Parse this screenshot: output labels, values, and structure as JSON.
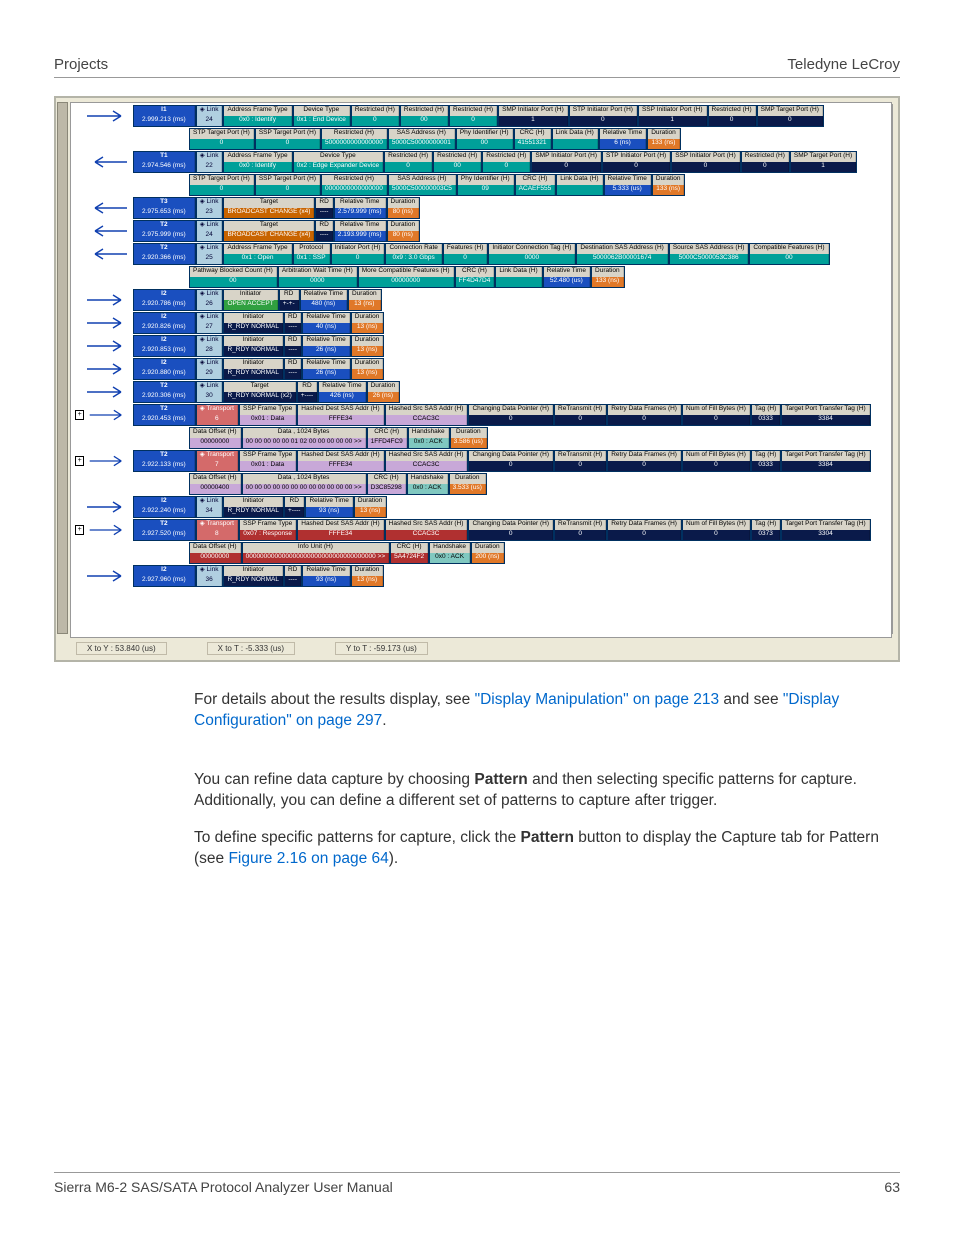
{
  "header": {
    "left": "Projects",
    "right": "Teledyne LeCroy"
  },
  "footer": {
    "left": "Sierra M6-2 SAS/SATA Protocol Analyzer User Manual",
    "right": "63"
  },
  "body": {
    "p1_pre": "For details about the results display, see ",
    "p1_link1": "\"Display Manipulation\" on page 213",
    "p1_mid": " and see ",
    "p1_link2": "\"Display Configuration\" on page 297",
    "p1_post": ".",
    "p2_a": "You can refine data capture by choosing ",
    "p2_bold": "Pattern",
    "p2_b": " and then selecting specific patterns for capture. Additionally, you can define a different set of patterns to capture after trigger.",
    "p3_a": "To define specific patterns for capture, click the ",
    "p3_bold": "Pattern",
    "p3_b": " button to display the Capture tab for Pattern (see ",
    "p3_link": "Figure 2.16 on page 64",
    "p3_c": ")."
  },
  "status": {
    "x1": "X to Y : 53.840 (us)",
    "x2": "X to T : -5.333 (us)",
    "x3": "Y to T : -59.173 (us)"
  },
  "cols": {
    "aft": "Address Frame Type",
    "devt": "Device Type",
    "restr": "Restricted (H)",
    "smpip": "SMP Initiator Port (H)",
    "stpip": "STP Initiator Port (H)",
    "sspip": "SSP Initiator Port (H)",
    "smptp": "SMP Target Port (H)",
    "stptp": "STP Target Port (H)",
    "ssptp": "SSP Target Port (H)",
    "sasaddr": "SAS Address (H)",
    "phyid": "Phy Identifier (H)",
    "crc": "CRC (H)",
    "linkdata": "Link Data (H)",
    "reltime": "Relative Time",
    "dur": "Duration",
    "proto": "Protocol",
    "iport": "Initiator Port (H)",
    "crate": "Connection Rate",
    "feat": "Features (H)",
    "ictag": "Initiator Connection Tag (H)",
    "dsas": "Destination SAS Address (H)",
    "ssas": "Source SAS Address (H)",
    "cfeat": "Compatible Features (H)",
    "pbcnt": "Pathway Blocked Count (H)",
    "awt": "Arbitration Wait Time (H)",
    "mcf": "More Compatible Features (H)",
    "init": "Initiator",
    "rd": "RD",
    "target": "Target",
    "sspft": "SSP Frame Type",
    "hdsas": "Hashed Dest SAS Addr (H)",
    "hssas": "Hashed Src SAS Addr (H)",
    "cdp": "Changing Data Pointer (H)",
    "retx": "ReTransmit (H)",
    "rdf": "Retry Data Frames (H)",
    "nfb": "Num of Fill Bytes (H)",
    "tag": "Tag (H)",
    "tptt": "Target Port Transfer Tag (H)",
    "doff": "Data Offset (H)",
    "data1024": "Data , 1024 Bytes",
    "hshake": "Handshake",
    "infounit": "Info Unit (H)",
    "link": "Link",
    "trans": "Transport"
  },
  "rows": [
    {
      "id": "I1",
      "time": "2.999.213 (ms)",
      "idx": "24",
      "kind": "link",
      "cells": [
        [
          "aft",
          "0x0 : Identify",
          "teal"
        ],
        [
          "devt",
          "0x1 : End Device",
          "teal"
        ],
        [
          "restr",
          "0",
          "teal"
        ],
        [
          "restr",
          "00",
          "teal"
        ],
        [
          "restr",
          "0",
          "teal"
        ],
        [
          "smpip",
          "1",
          "navy"
        ],
        [
          "stpip",
          "0",
          "navy"
        ],
        [
          "sspip",
          "1",
          "navy"
        ],
        [
          "restr",
          "0",
          "navy"
        ],
        [
          "smptp",
          "0",
          "navy"
        ]
      ]
    },
    {
      "sub": true,
      "cells": [
        [
          "stptp",
          "0",
          "teal",
          true
        ],
        [
          "ssptp",
          "0",
          "teal",
          true
        ],
        [
          "restr",
          "5000000000000000",
          "teal"
        ],
        [
          "sasaddr",
          "5000C50000000001",
          "teal"
        ],
        [
          "phyid",
          "00",
          "teal"
        ],
        [
          "crc",
          "41551321",
          "teal"
        ],
        [
          "linkdata",
          "",
          "teal"
        ],
        [
          "reltime",
          "6 (ns)",
          "blue"
        ],
        [
          "dur",
          "133 (ns)",
          "orange"
        ]
      ]
    },
    {
      "id": "T1",
      "time": "2.974.546 (ms)",
      "idx": "22",
      "kind": "link",
      "dir": "in",
      "cells": [
        [
          "aft",
          "0x0 : Identify",
          "teal"
        ],
        [
          "devt",
          "0x2 : Edge Expander Device",
          "teal"
        ],
        [
          "restr",
          "0",
          "teal"
        ],
        [
          "restr",
          "00",
          "teal"
        ],
        [
          "restr",
          "0",
          "teal"
        ],
        [
          "smpip",
          "0",
          "navy"
        ],
        [
          "stpip",
          "0",
          "navy"
        ],
        [
          "sspip",
          "0",
          "navy"
        ],
        [
          "restr",
          "0",
          "navy"
        ],
        [
          "smptp",
          "1",
          "navy"
        ]
      ]
    },
    {
      "sub": true,
      "cells": [
        [
          "stptp",
          "0",
          "teal",
          true
        ],
        [
          "ssptp",
          "0",
          "teal",
          true
        ],
        [
          "restr",
          "0000000000000000",
          "teal"
        ],
        [
          "sasaddr",
          "5000C500000003C5",
          "teal"
        ],
        [
          "phyid",
          "09",
          "teal"
        ],
        [
          "crc",
          "ACAEF555",
          "teal"
        ],
        [
          "linkdata",
          "",
          "teal"
        ],
        [
          "reltime",
          "5.333 (us)",
          "blue"
        ],
        [
          "dur",
          "133 (ns)",
          "orange"
        ]
      ]
    },
    {
      "id": "T3",
      "time": "2.975.653 (ms)",
      "idx": "23",
      "kind": "link",
      "dir": "in",
      "cells": [
        [
          "target",
          "BROADCAST CHANGE (x4)",
          "dorange"
        ],
        [
          "rd",
          "----",
          "navy"
        ],
        [
          "reltime",
          "2.579.999 (ms)",
          "blue"
        ],
        [
          "dur",
          "80 (ns)",
          "orange"
        ]
      ]
    },
    {
      "id": "T2",
      "time": "2.975.999 (ms)",
      "idx": "24",
      "kind": "link",
      "dir": "in",
      "cells": [
        [
          "target",
          "BROADCAST CHANGE (x4)",
          "dorange"
        ],
        [
          "rd",
          "----",
          "navy"
        ],
        [
          "reltime",
          "2.193.999 (ms)",
          "blue"
        ],
        [
          "dur",
          "80 (ns)",
          "orange"
        ]
      ]
    },
    {
      "id": "T2",
      "time": "2.920.366 (ms)",
      "idx": "25",
      "kind": "link",
      "dir": "in",
      "cells": [
        [
          "aft",
          "0x1 : Open",
          "teal"
        ],
        [
          "proto",
          "0x1 : SSP",
          "teal"
        ],
        [
          "iport",
          "0",
          "teal"
        ],
        [
          "crate",
          "0x9 : 3.0 Gbps",
          "teal"
        ],
        [
          "feat",
          "0",
          "teal"
        ],
        [
          "ictag",
          "0000",
          "teal"
        ],
        [
          "dsas",
          "5000062B00001674",
          "teal"
        ],
        [
          "ssas",
          "5000C5000053C386",
          "teal"
        ],
        [
          "cfeat",
          "00",
          "teal"
        ]
      ]
    },
    {
      "sub": true,
      "cells": [
        [
          "pbcnt",
          "00",
          "teal",
          true
        ],
        [
          "awt",
          "0000",
          "teal"
        ],
        [
          "mcf",
          "00000000",
          "teal"
        ],
        [
          "crc",
          "FF4D47D4",
          "teal"
        ],
        [
          "linkdata",
          "",
          "teal"
        ],
        [
          "reltime",
          "52.480 (us)",
          "blue"
        ],
        [
          "dur",
          "133 (ns)",
          "orange"
        ]
      ]
    },
    {
      "id": "I2",
      "time": "2.920.786 (ms)",
      "idx": "26",
      "kind": "link",
      "dir": "out",
      "cells": [
        [
          "init",
          "OPEN ACCEPT",
          "green"
        ],
        [
          "rd",
          "+-+-",
          "navy"
        ],
        [
          "reltime",
          "480 (ns)",
          "blue"
        ],
        [
          "dur",
          "13 (ns)",
          "orange"
        ]
      ]
    },
    {
      "id": "I2",
      "time": "2.920.826 (ms)",
      "idx": "27",
      "kind": "link",
      "dir": "out",
      "cells": [
        [
          "init",
          "R_RDY NORMAL",
          "navy"
        ],
        [
          "rd",
          "----",
          "navy"
        ],
        [
          "reltime",
          "40 (ns)",
          "blue"
        ],
        [
          "dur",
          "13 (ns)",
          "orange"
        ]
      ]
    },
    {
      "id": "I2",
      "time": "2.920.853 (ms)",
      "idx": "28",
      "kind": "link",
      "dir": "out",
      "cells": [
        [
          "init",
          "R_RDY NORMAL",
          "navy"
        ],
        [
          "rd",
          "----",
          "navy"
        ],
        [
          "reltime",
          "26 (ns)",
          "blue"
        ],
        [
          "dur",
          "13 (ns)",
          "orange"
        ]
      ]
    },
    {
      "id": "I2",
      "time": "2.920.880 (ms)",
      "idx": "29",
      "kind": "link",
      "dir": "out",
      "cells": [
        [
          "init",
          "R_RDY NORMAL",
          "navy"
        ],
        [
          "rd",
          "----",
          "navy"
        ],
        [
          "reltime",
          "26 (ns)",
          "blue"
        ],
        [
          "dur",
          "13 (ns)",
          "orange"
        ]
      ]
    },
    {
      "id": "T2",
      "time": "2.920.306 (ms)",
      "idx": "30",
      "kind": "link",
      "dir": "out",
      "cells": [
        [
          "target",
          "R_RDY NORMAL (x2)",
          "navy"
        ],
        [
          "rd",
          "+----",
          "navy"
        ],
        [
          "reltime",
          "426 (ns)",
          "blue"
        ],
        [
          "dur",
          "26 (ns)",
          "orange"
        ]
      ]
    },
    {
      "id": "T2",
      "time": "2.920.453 (ms)",
      "idx": "6",
      "kind": "trans",
      "exp": true,
      "cells": [
        [
          "sspft",
          "0x01 : Data",
          "lpurple"
        ],
        [
          "hdsas",
          "FFFE34",
          "lpurple"
        ],
        [
          "hssas",
          "CCAC3C",
          "lpurple"
        ],
        [
          "cdp",
          "0",
          "navy"
        ],
        [
          "retx",
          "0",
          "navy"
        ],
        [
          "rdf",
          "0",
          "navy"
        ],
        [
          "nfb",
          "0",
          "navy"
        ],
        [
          "tag",
          "0333",
          "navy"
        ],
        [
          "tptt",
          "3384",
          "navy"
        ]
      ]
    },
    {
      "sub": true,
      "cells": [
        [
          "doff",
          "00000000",
          "lpurple",
          true
        ],
        [
          "data1024",
          "00 00 00 00 00 01 02 00 00 00 00 00 >>",
          "lpurple"
        ],
        [
          "crc",
          "1FFD4FC9",
          "lpurple"
        ],
        [
          "hshake",
          "0x0 : ACK",
          "ltteal"
        ],
        [
          "dur",
          "3.586 (us)",
          "orange"
        ]
      ]
    },
    {
      "id": "T2",
      "time": "2.922.133 (ms)",
      "idx": "7",
      "kind": "trans",
      "exp": true,
      "cells": [
        [
          "sspft",
          "0x01 : Data",
          "lpurple"
        ],
        [
          "hdsas",
          "FFFE34",
          "lpurple"
        ],
        [
          "hssas",
          "CCAC3C",
          "lpurple"
        ],
        [
          "cdp",
          "0",
          "navy"
        ],
        [
          "retx",
          "0",
          "navy"
        ],
        [
          "rdf",
          "0",
          "navy"
        ],
        [
          "nfb",
          "0",
          "navy"
        ],
        [
          "tag",
          "0333",
          "navy"
        ],
        [
          "tptt",
          "3384",
          "navy"
        ]
      ]
    },
    {
      "sub": true,
      "cells": [
        [
          "doff",
          "00000400",
          "lpurple",
          true
        ],
        [
          "data1024",
          "00 00 00 00 00 00 00 00 00 00 00 00 >>",
          "lpurple"
        ],
        [
          "crc",
          "D3C85298",
          "lpurple"
        ],
        [
          "hshake",
          "0x0 : ACK",
          "ltteal"
        ],
        [
          "dur",
          "3.533 (us)",
          "orange"
        ]
      ]
    },
    {
      "id": "I2",
      "time": "2.922.240 (ms)",
      "idx": "34",
      "kind": "link",
      "dir": "out",
      "cells": [
        [
          "init",
          "R_RDY NORMAL",
          "navy"
        ],
        [
          "rd",
          "+----",
          "navy"
        ],
        [
          "reltime",
          "93 (ns)",
          "blue"
        ],
        [
          "dur",
          "13 (ns)",
          "orange"
        ]
      ]
    },
    {
      "id": "T2",
      "time": "2.927.520 (ms)",
      "idx": "8",
      "kind": "trans",
      "exp": true,
      "cells": [
        [
          "sspft",
          "0x07 : Response",
          "red"
        ],
        [
          "hdsas",
          "FFFE34",
          "red"
        ],
        [
          "hssas",
          "CCAC3C",
          "red"
        ],
        [
          "cdp",
          "0",
          "navy"
        ],
        [
          "retx",
          "0",
          "navy"
        ],
        [
          "rdf",
          "0",
          "navy"
        ],
        [
          "nfb",
          "0",
          "navy"
        ],
        [
          "tag",
          "0373",
          "navy"
        ],
        [
          "tptt",
          "3304",
          "navy"
        ]
      ]
    },
    {
      "sub": true,
      "cells": [
        [
          "doff",
          "00000000",
          "red",
          true
        ],
        [
          "infounit",
          "000000000000000000000000000000000000 >>",
          "red"
        ],
        [
          "crc",
          "5A4724F2",
          "red"
        ],
        [
          "hshake",
          "0x0 : ACK",
          "ltteal"
        ],
        [
          "dur",
          "200 (ns)",
          "orange"
        ]
      ]
    },
    {
      "id": "I2",
      "time": "2.927.960 (ms)",
      "idx": "36",
      "kind": "link",
      "dir": "out",
      "cells": [
        [
          "init",
          "R_RDY NORMAL",
          "navy"
        ],
        [
          "rd",
          "----",
          "navy"
        ],
        [
          "reltime",
          "93 (ns)",
          "blue"
        ],
        [
          "dur",
          "13 (ns)",
          "orange"
        ]
      ]
    }
  ]
}
